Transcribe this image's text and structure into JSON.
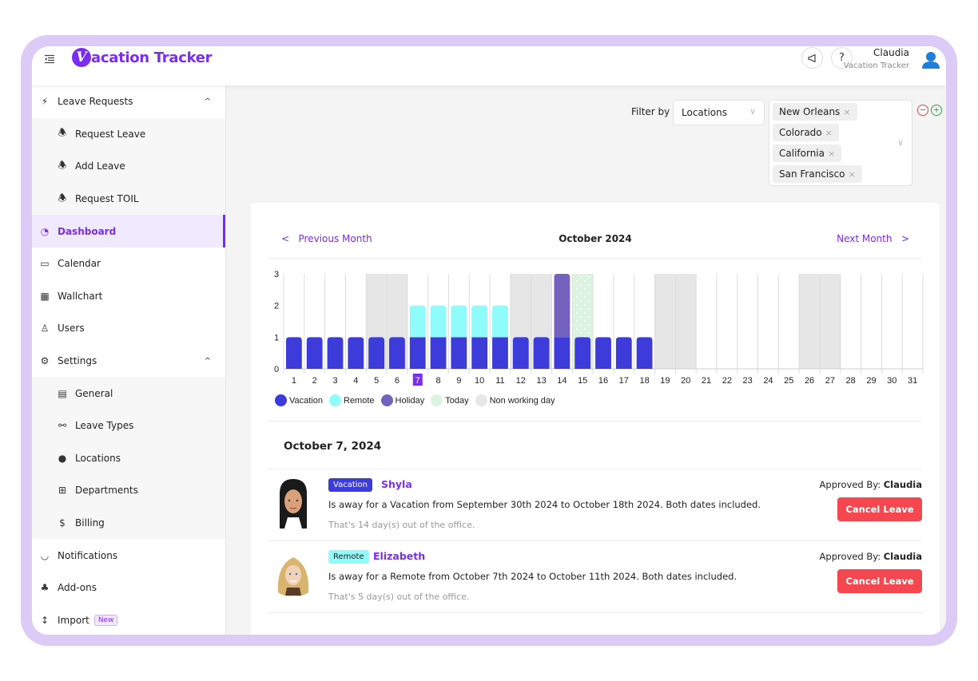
{
  "header": {
    "app_name": "Vacation Tracker",
    "logo_letter": "V",
    "logo_rest": "acation Tracker",
    "user_name": "Claudia",
    "user_org": "Vacation Tracker",
    "announce_icon": "megaphone-icon",
    "help_label": "?"
  },
  "sidebar": {
    "items": [
      {
        "label": "Leave Requests",
        "icon": "⚡",
        "type": "group",
        "expanded": true
      },
      {
        "label": "Request Leave",
        "icon": "🕭",
        "type": "sub"
      },
      {
        "label": "Add Leave",
        "icon": "🕭",
        "type": "sub"
      },
      {
        "label": "Request TOIL",
        "icon": "🕭",
        "type": "sub"
      },
      {
        "label": "Dashboard",
        "icon": "◔",
        "type": "item",
        "active": true
      },
      {
        "label": "Calendar",
        "icon": "▭",
        "type": "item"
      },
      {
        "label": "Wallchart",
        "icon": "▦",
        "type": "item"
      },
      {
        "label": "Users",
        "icon": "♙",
        "type": "item"
      },
      {
        "label": "Settings",
        "icon": "⚙",
        "type": "group",
        "expanded": true
      },
      {
        "label": "General",
        "icon": "▤",
        "type": "sub"
      },
      {
        "label": "Leave Types",
        "icon": "⚯",
        "type": "sub"
      },
      {
        "label": "Locations",
        "icon": "●",
        "type": "sub"
      },
      {
        "label": "Departments",
        "icon": "⊞",
        "type": "sub"
      },
      {
        "label": "Billing",
        "icon": "$",
        "type": "sub"
      },
      {
        "label": "Notifications",
        "icon": "◡",
        "type": "item"
      },
      {
        "label": "Add-ons",
        "icon": "♣",
        "type": "item"
      },
      {
        "label": "Import",
        "icon": "↕",
        "type": "item",
        "badge": "New"
      }
    ],
    "chevron_up": "^"
  },
  "filter": {
    "label": "Filter by",
    "select_value": "Locations",
    "tags": [
      "New Orleans",
      "Colorado",
      "California",
      "San Francisco"
    ],
    "remove_symbol": "×",
    "minus_symbol": "−",
    "plus_symbol": "+",
    "minus_color": "#e0463f",
    "plus_color": "#2e9e46"
  },
  "calendar": {
    "prev_label": "Previous Month",
    "next_label": "Next Month",
    "month_title": "October 2024",
    "prev_chevron": "<",
    "next_chevron": ">"
  },
  "chart_data": {
    "type": "bar",
    "stacked": true,
    "title": "October 2024",
    "categories": [
      "1",
      "2",
      "3",
      "4",
      "5",
      "6",
      "7",
      "8",
      "9",
      "10",
      "11",
      "12",
      "13",
      "14",
      "15",
      "16",
      "17",
      "18",
      "19",
      "20",
      "21",
      "22",
      "23",
      "24",
      "25",
      "26",
      "27",
      "28",
      "29",
      "30",
      "31"
    ],
    "series": [
      {
        "name": "Vacation",
        "color": "#3e3bdb",
        "values": [
          1,
          1,
          1,
          1,
          1,
          1,
          1,
          1,
          1,
          1,
          1,
          1,
          1,
          1,
          1,
          1,
          1,
          1,
          0,
          0,
          0,
          0,
          0,
          0,
          0,
          0,
          0,
          0,
          0,
          0,
          0
        ]
      },
      {
        "name": "Remote",
        "color": "#8ffcfb",
        "values": [
          0,
          0,
          0,
          0,
          0,
          0,
          1,
          1,
          1,
          1,
          1,
          0,
          0,
          0,
          0,
          0,
          0,
          0,
          0,
          0,
          0,
          0,
          0,
          0,
          0,
          0,
          0,
          0,
          0,
          0,
          0
        ]
      },
      {
        "name": "Holiday",
        "color": "#7363bf",
        "values": [
          0,
          0,
          0,
          0,
          0,
          0,
          0,
          0,
          0,
          0,
          0,
          0,
          0,
          2,
          0,
          0,
          0,
          0,
          0,
          0,
          0,
          0,
          0,
          0,
          0,
          0,
          0,
          0,
          0,
          0,
          0
        ]
      }
    ],
    "today": "15",
    "today_color": "#dcf3e2",
    "non_working_days": [
      "5",
      "6",
      "12",
      "13",
      "19",
      "20",
      "26",
      "27"
    ],
    "non_working_color": "#e6e6e6",
    "selected_day": "7",
    "selected_color": "#7a2df0",
    "ylim": [
      0,
      3
    ],
    "yticks": [
      0,
      1,
      2,
      3
    ],
    "xlabel": "",
    "ylabel": "",
    "grid": true,
    "legend": [
      {
        "name": "Vacation",
        "color": "#3e3bdb"
      },
      {
        "name": "Remote",
        "color": "#8ffcfb"
      },
      {
        "name": "Holiday",
        "color": "#7363bf"
      },
      {
        "name": "Today",
        "color": "#dcf3e2"
      },
      {
        "name": "Non working day",
        "color": "#e6e6e6"
      }
    ],
    "legend_position": "bottom-left"
  },
  "day_detail": {
    "title": "October 7, 2024",
    "leaves": [
      {
        "type": "Vacation",
        "type_bg": "#3e3bdb",
        "type_color": "#ffffff",
        "name": "Shyla",
        "description": "Is away for a Vacation from September 30th 2024 to October 18th 2024. Both dates included.",
        "days_text": "That's 14 day(s) out of the office.",
        "approved_label": "Approved By:",
        "approved_by": "Claudia",
        "cancel_label": "Cancel Leave"
      },
      {
        "type": "Remote",
        "type_bg": "#8ffcfb",
        "type_color": "#222222",
        "name": "Elizabeth",
        "description": "Is away for a Remote from October 7th 2024 to October 11th 2024. Both dates included.",
        "days_text": "That's 5 day(s) out of the office.",
        "approved_label": "Approved By:",
        "approved_by": "Claudia",
        "cancel_label": "Cancel Leave"
      }
    ]
  }
}
